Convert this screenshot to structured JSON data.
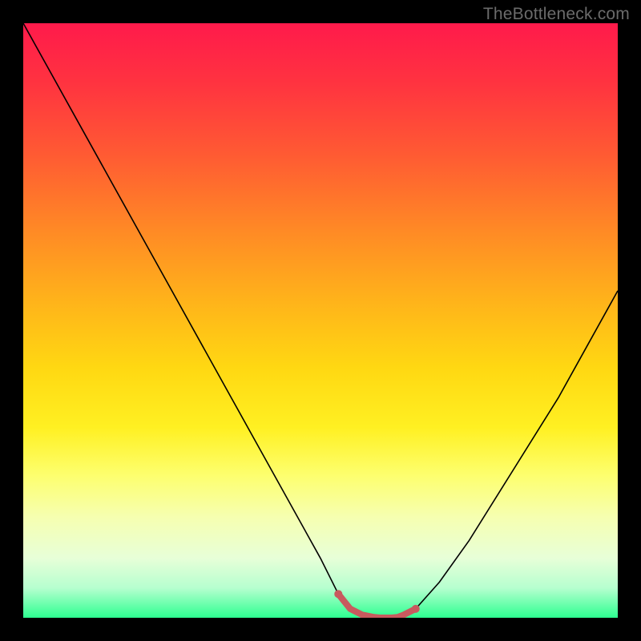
{
  "attribution": "TheBottleneck.com",
  "colors": {
    "marker": "#c85a5e",
    "curve": "#000000",
    "gradient_top": "#ff1a4b",
    "gradient_bottom": "#2dff90"
  },
  "chart_data": {
    "type": "line",
    "title": "",
    "xlabel": "",
    "ylabel": "",
    "xlim": [
      0,
      100
    ],
    "ylim": [
      0,
      100
    ],
    "grid": false,
    "legend": false,
    "series": [
      {
        "name": "bottleneck-curve",
        "x": [
          0,
          5,
          10,
          15,
          20,
          25,
          30,
          35,
          40,
          45,
          50,
          53,
          55,
          57,
          60,
          62,
          64,
          66,
          70,
          75,
          80,
          85,
          90,
          95,
          100
        ],
        "values": [
          100,
          91,
          82,
          73,
          64,
          55,
          46,
          37,
          28,
          19,
          10,
          4,
          1.5,
          0.5,
          0,
          0,
          0.5,
          1.5,
          6,
          13,
          21,
          29,
          37,
          46,
          55
        ]
      }
    ],
    "highlight": {
      "name": "optimal-range",
      "x_start": 53,
      "x_end": 66,
      "points_x": [
        53,
        55,
        57,
        59,
        60,
        61,
        62,
        63,
        64,
        65,
        66
      ],
      "points_values": [
        4,
        1.5,
        0.5,
        0.1,
        0,
        0,
        0,
        0.1,
        0.5,
        1,
        1.5
      ]
    }
  }
}
